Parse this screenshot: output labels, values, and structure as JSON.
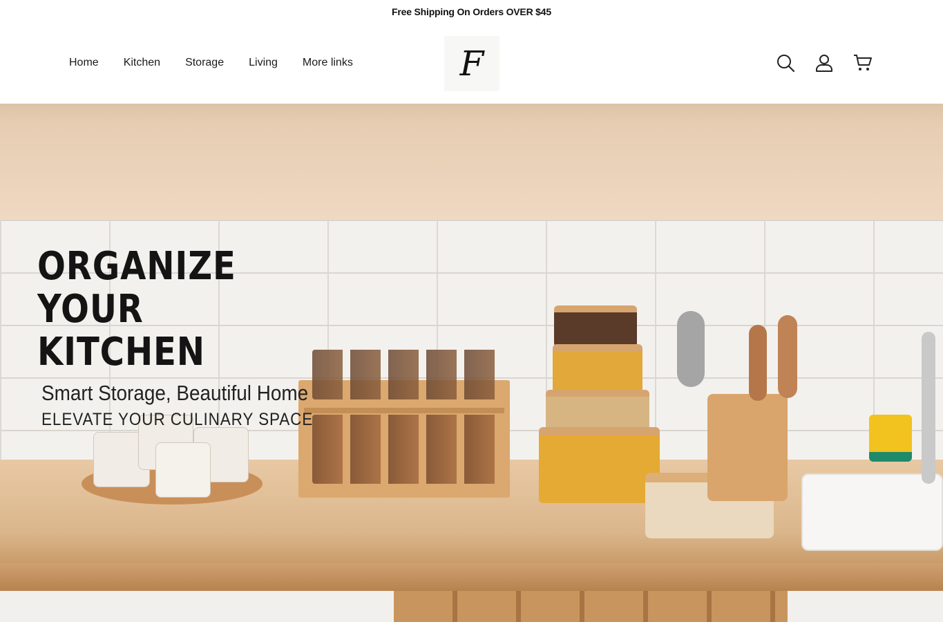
{
  "announcement": "Free Shipping On Orders OVER $45",
  "nav": {
    "items": [
      "Home",
      "Kitchen",
      "Storage",
      "Living",
      "More links"
    ]
  },
  "logo": {
    "letter": "F"
  },
  "header_icons": [
    "search-icon",
    "account-icon",
    "cart-icon"
  ],
  "hero": {
    "title_line1": "ORGANIZE YOUR",
    "title_line2": "KITCHEN",
    "subtitle": "Smart Storage, Beautiful Home",
    "tagline": "ELEVATE YOUR CULINARY SPACE"
  },
  "colors": {
    "wall_top": "#e6cdb2",
    "tile": "#f3f1ee",
    "counter": "#dbb68c",
    "text": "#141414"
  }
}
